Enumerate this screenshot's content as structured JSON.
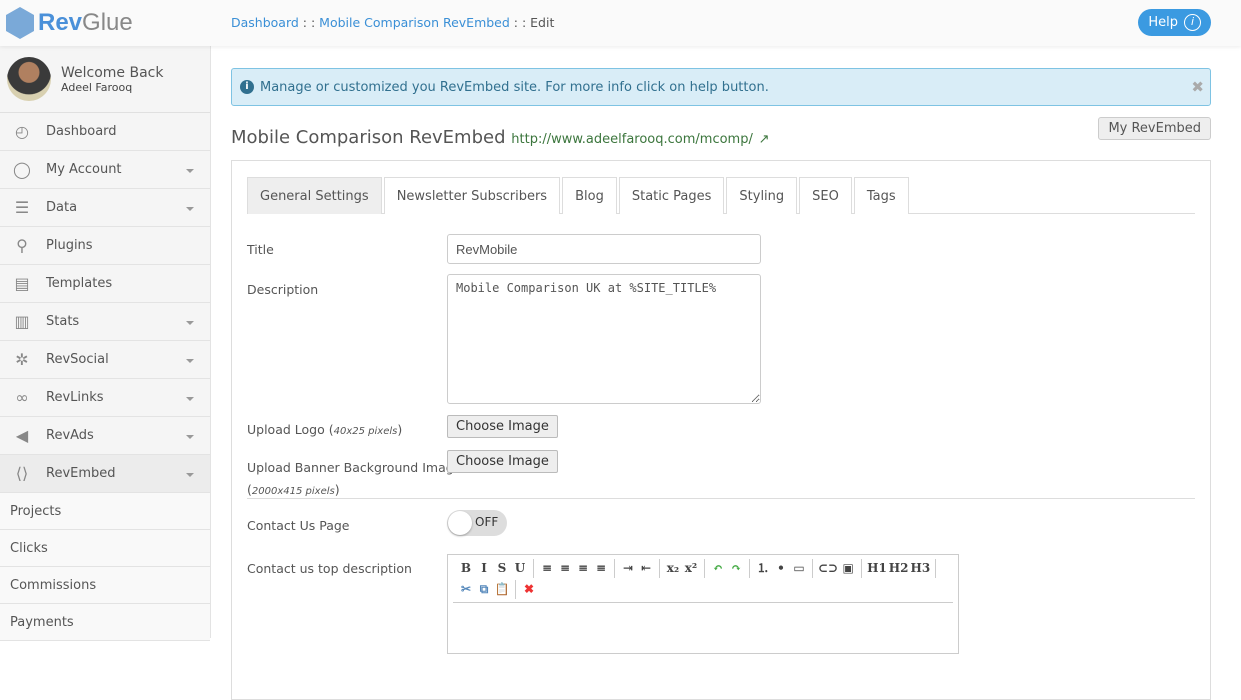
{
  "header": {
    "logo_rev": "Rev",
    "logo_glue": "Glue",
    "breadcrumb": [
      "Dashboard",
      "Mobile Comparison RevEmbed",
      "Edit"
    ],
    "sep": " : : ",
    "help": "Help"
  },
  "sidebar": {
    "welcome": "Welcome Back",
    "user": "Adeel Farooq",
    "items": [
      {
        "label": "Dashboard",
        "icon": "◴"
      },
      {
        "label": "My Account",
        "icon": "◯"
      },
      {
        "label": "Data",
        "icon": "☰"
      },
      {
        "label": "Plugins",
        "icon": "⚲"
      },
      {
        "label": "Templates",
        "icon": "▤"
      },
      {
        "label": "Stats",
        "icon": "▥"
      },
      {
        "label": "RevSocial",
        "icon": "✲"
      },
      {
        "label": "RevLinks",
        "icon": "∞"
      },
      {
        "label": "RevAds",
        "icon": "◀"
      },
      {
        "label": "RevEmbed",
        "icon": "⟨⟩"
      }
    ],
    "subitems": [
      "Projects",
      "Clicks",
      "Commissions",
      "Payments"
    ]
  },
  "alert": "Manage or customized you RevEmbed site. For more info click on help button.",
  "page": {
    "title": "Mobile Comparison RevEmbed",
    "url": "http://www.adeelfarooq.com/mcomp/",
    "my_button": "My RevEmbed"
  },
  "tabs": [
    "General Settings",
    "Newsletter Subscribers",
    "Blog",
    "Static Pages",
    "Styling",
    "SEO",
    "Tags"
  ],
  "form": {
    "title_label": "Title",
    "title_value": "RevMobile",
    "desc_label": "Description",
    "desc_value": "Mobile Comparison UK at %SITE_TITLE%",
    "logo_label": "Upload Logo",
    "logo_hint": "40x25 pixels",
    "banner_label": "Upload Banner Background Image",
    "banner_hint": "2000x415 pixels",
    "choose": "Choose Image",
    "contact_label": "Contact Us Page",
    "contact_toggle": "OFF",
    "contact_desc_label": "Contact us top description"
  },
  "toolbar": [
    "B",
    "I",
    "S",
    "U",
    "|",
    "≡",
    "≡",
    "≡",
    "≡",
    "|",
    "⇥",
    "⇤",
    "|",
    "x₂",
    "x²",
    "|",
    "↶",
    "↷",
    "|",
    "⒈",
    "•",
    "▭",
    "|",
    "⊂⊃",
    "▣",
    "|",
    "H1",
    "H2",
    "H3",
    "|",
    "✂",
    "⧉",
    "📋",
    "|",
    "✖"
  ]
}
